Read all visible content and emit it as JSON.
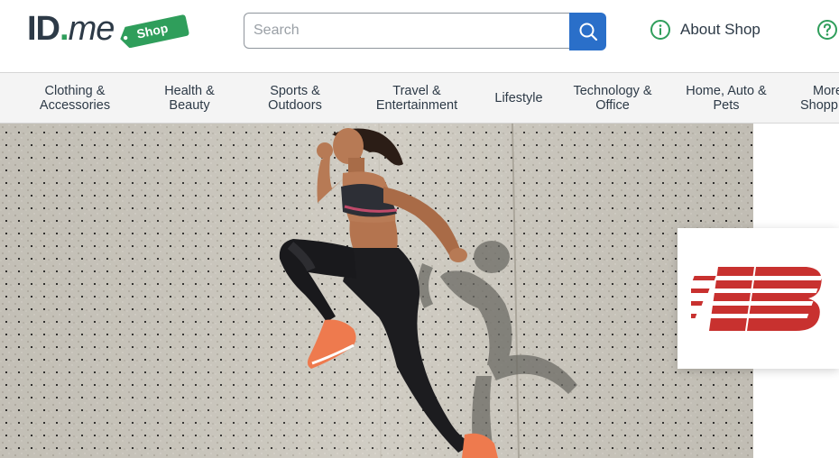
{
  "header": {
    "logo_text_id": "ID",
    "logo_text_dot": ".",
    "logo_text_me": "me",
    "logo_tag": "Shop",
    "search_placeholder": "Search",
    "about_label": "About Shop",
    "colors": {
      "brand_green": "#2f9e5b",
      "search_blue": "#2a6fc9"
    },
    "icons": {
      "search": "search-icon",
      "about": "info-icon",
      "help": "question-icon"
    }
  },
  "nav": {
    "categories": [
      {
        "line1": "Clothing &",
        "line2": "Accessories"
      },
      {
        "line1": "Health &",
        "line2": "Beauty"
      },
      {
        "line1": "Sports &",
        "line2": "Outdoors"
      },
      {
        "line1": "Travel &",
        "line2": "Entertainment"
      },
      {
        "line1": "Lifestyle",
        "line2": ""
      },
      {
        "line1": "Technology &",
        "line2": "Office"
      },
      {
        "line1": "Home, Auto &",
        "line2": "Pets"
      },
      {
        "line1": "More",
        "line2": "Shopp"
      }
    ]
  },
  "hero": {
    "brand_logo": "new-balance-logo",
    "brand_color": "#c8312f"
  }
}
